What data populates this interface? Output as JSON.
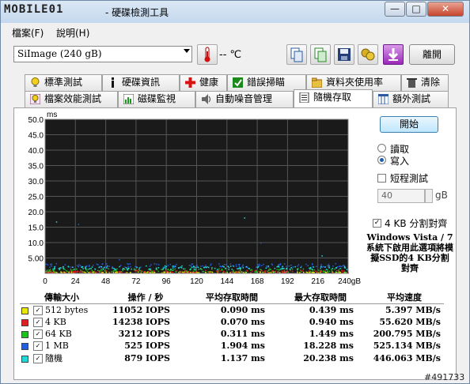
{
  "window": {
    "logo": "MOBILE01",
    "title": "- 硬碟檢測工具",
    "min": "—",
    "max": "□",
    "close": "✕"
  },
  "menu": [
    {
      "label": "檔案(F)"
    },
    {
      "label": "說明(H)"
    }
  ],
  "toolbar": {
    "drive": "SiImage  (240 gB)",
    "temperature": "-- ℃",
    "exit_label": "離開"
  },
  "tabs_row1": [
    {
      "label": "標準測試",
      "icon": "bulb-icon"
    },
    {
      "label": "硬碟資訊",
      "icon": "info-icon"
    },
    {
      "label": "健康",
      "icon": "health-cross-icon"
    },
    {
      "label": "錯誤掃瞄",
      "icon": "check-mark-icon"
    },
    {
      "label": "資料夾使用率",
      "icon": "folder-icon"
    },
    {
      "label": "清除",
      "icon": "trash-icon"
    }
  ],
  "tabs_row2": [
    {
      "label": "檔案效能測試",
      "icon": "bulb-icon"
    },
    {
      "label": "磁碟監視",
      "icon": "monitor-chart-icon"
    },
    {
      "label": "自動噪音管理",
      "icon": "speaker-icon"
    },
    {
      "label": "隨機存取",
      "icon": "page-icon"
    },
    {
      "label": "額外測試",
      "icon": "grid-icon"
    }
  ],
  "controls": {
    "start_label": "開始",
    "read_label": "讀取",
    "write_label": "寫入",
    "read_selected": false,
    "write_selected": true,
    "short_test_label": "短程測試",
    "short_test_value": "40",
    "short_test_unit": "gB",
    "align_label": "4 KB 分割對齊",
    "note": "Windows Vista / 7 系統下啟用此選項將模擬SSD的4 KB分割對齊"
  },
  "chart_data": {
    "type": "scatter",
    "ylabel": "ms",
    "y_ticks": [
      "50.0",
      "45.0",
      "40.0",
      "35.0",
      "30.0",
      "25.0",
      "20.0",
      "15.0",
      "10.0",
      "5.00"
    ],
    "x_ticks": [
      "0",
      "24",
      "48",
      "72",
      "96",
      "120",
      "144",
      "168",
      "192",
      "216",
      "240gB"
    ],
    "xlim": [
      0,
      240
    ],
    "ylim": [
      0,
      50
    ],
    "grid": true,
    "background": "#1a1a1a",
    "series": [
      {
        "color": "#e6e600",
        "values_ms": [
          0.09,
          0.44
        ]
      },
      {
        "color": "#e02020",
        "values_ms": [
          0.07,
          0.94
        ]
      },
      {
        "color": "#20c020",
        "values_ms": [
          0.31,
          1.45
        ]
      },
      {
        "color": "#2060e0",
        "values_ms": [
          1.9,
          18.2
        ]
      },
      {
        "color": "#20e0e0",
        "values_ms": [
          1.14,
          20.2
        ]
      }
    ]
  },
  "results": {
    "headers": [
      "傳輸大小",
      "操作 / 秒",
      "平均存取時間",
      "最大存取時間",
      "平均速度"
    ],
    "rows": [
      {
        "color": "#e8e800",
        "size": "512 bytes",
        "ops": "11052 IOPS",
        "avg": "0.090 ms",
        "max": "0.439 ms",
        "speed": "5.397 MB/s"
      },
      {
        "color": "#e02020",
        "size": "4 KB",
        "ops": "14238 IOPS",
        "avg": "0.070 ms",
        "max": "0.940 ms",
        "speed": "55.620 MB/s"
      },
      {
        "color": "#20c020",
        "size": "64 KB",
        "ops": "3212 IOPS",
        "avg": "0.311 ms",
        "max": "1.449 ms",
        "speed": "200.795 MB/s"
      },
      {
        "color": "#2060e0",
        "size": "1 MB",
        "ops": "525 IOPS",
        "avg": "1.904 ms",
        "max": "18.228 ms",
        "speed": "525.134 MB/s"
      },
      {
        "color": "#20d8d8",
        "size": "隨機",
        "ops": "879 IOPS",
        "avg": "1.137 ms",
        "max": "20.238 ms",
        "speed": "446.063 MB/s"
      }
    ]
  },
  "watermark": "#491733"
}
